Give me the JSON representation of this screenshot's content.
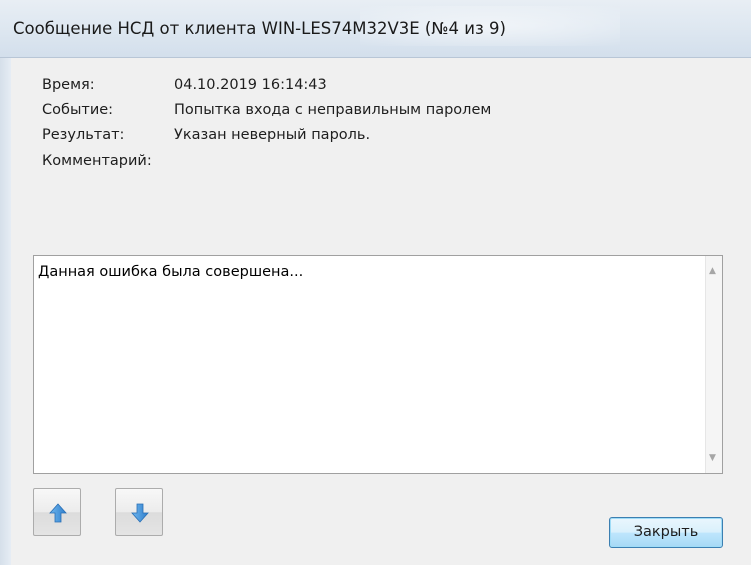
{
  "window": {
    "title": "Сообщение НСД от клиента WIN-LES74M32V3E (№4 из 9)"
  },
  "fields": [
    {
      "label": "Время:",
      "value": "04.10.2019 16:14:43"
    },
    {
      "label": "Событие:",
      "value": "Попытка входа с неправильным паролем"
    },
    {
      "label": "Результат:",
      "value": "Указан неверный пароль."
    },
    {
      "label": "Комментарий:",
      "value": ""
    }
  ],
  "memo": {
    "text": "Данная ошибка была совершена..."
  },
  "buttons": {
    "up_icon": "arrow-up-icon",
    "down_icon": "arrow-down-icon",
    "close_label": "Закрыть"
  },
  "colors": {
    "arrow_blue": "#3a8fd8",
    "close_border": "#3c7fb1"
  }
}
